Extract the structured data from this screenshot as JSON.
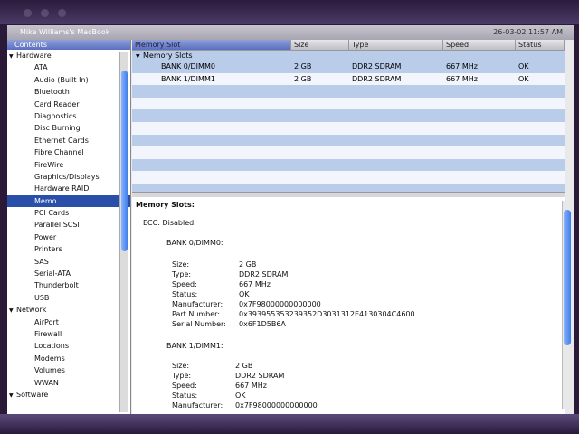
{
  "titlebar": {
    "title": "Mike Williams's MacBook",
    "timestamp": "26-03-02 11:57 AM"
  },
  "sidebar": {
    "header": "Contents",
    "items": [
      {
        "label": "Hardware",
        "type": "cat"
      },
      {
        "label": "ATA",
        "type": "sub"
      },
      {
        "label": "Audio (Built In)",
        "type": "sub"
      },
      {
        "label": "Bluetooth",
        "type": "sub"
      },
      {
        "label": "Card Reader",
        "type": "sub"
      },
      {
        "label": "Diagnostics",
        "type": "sub"
      },
      {
        "label": "Disc Burning",
        "type": "sub"
      },
      {
        "label": "Ethernet Cards",
        "type": "sub"
      },
      {
        "label": "Fibre Channel",
        "type": "sub"
      },
      {
        "label": "FireWire",
        "type": "sub"
      },
      {
        "label": "Graphics/Displays",
        "type": "sub"
      },
      {
        "label": "Hardware RAID",
        "type": "sub"
      },
      {
        "label": "Memo",
        "type": "sub",
        "selected": true
      },
      {
        "label": "PCI Cards",
        "type": "sub"
      },
      {
        "label": "Parallel SCSI",
        "type": "sub"
      },
      {
        "label": "Power",
        "type": "sub"
      },
      {
        "label": "Printers",
        "type": "sub"
      },
      {
        "label": "SAS",
        "type": "sub"
      },
      {
        "label": "Serial-ATA",
        "type": "sub"
      },
      {
        "label": "Thunderbolt",
        "type": "sub"
      },
      {
        "label": "USB",
        "type": "sub"
      },
      {
        "label": "Network",
        "type": "cat"
      },
      {
        "label": "AirPort",
        "type": "sub"
      },
      {
        "label": "Firewall",
        "type": "sub"
      },
      {
        "label": "Locations",
        "type": "sub"
      },
      {
        "label": "Modems",
        "type": "sub"
      },
      {
        "label": "Volumes",
        "type": "sub"
      },
      {
        "label": "WWAN",
        "type": "sub"
      },
      {
        "label": "Software",
        "type": "cat"
      }
    ]
  },
  "table": {
    "headers": [
      "Memory Slot",
      "Size",
      "Type",
      "Speed",
      "Status"
    ],
    "group": "Memory Slots",
    "rows": [
      [
        "BANK 0/DIMM0",
        "2 GB",
        "DDR2 SDRAM",
        "667 MHz",
        "OK"
      ],
      [
        "BANK 1/DIMM1",
        "2 GB",
        "DDR2 SDRAM",
        "667 MHz",
        "OK"
      ]
    ]
  },
  "detail": {
    "title": "Memory Slots:",
    "ecc": "ECC:  Disabled",
    "banks": [
      {
        "name": "BANK 0/DIMM0:",
        "fields": [
          [
            "Size:",
            "2 GB"
          ],
          [
            "Type:",
            "DDR2 SDRAM"
          ],
          [
            "Speed:",
            "667 MHz"
          ],
          [
            "Status:",
            "OK"
          ],
          [
            "Manufacturer:",
            "0x7F98000000000000"
          ],
          [
            "Part Number:",
            "0x393955353239352D3031312E4130304C4600"
          ],
          [
            "Serial Number:",
            "0x6F1D5B6A"
          ]
        ]
      },
      {
        "name": "BANK 1/DIMM1:",
        "fields": [
          [
            "Size:",
            "2 GB"
          ],
          [
            "Type:",
            "DDR2 SDRAM"
          ],
          [
            "Speed:",
            "667 MHz"
          ],
          [
            "Status:",
            "OK"
          ],
          [
            "Manufacturer:",
            "0x7F98000000000000"
          ]
        ]
      }
    ]
  }
}
